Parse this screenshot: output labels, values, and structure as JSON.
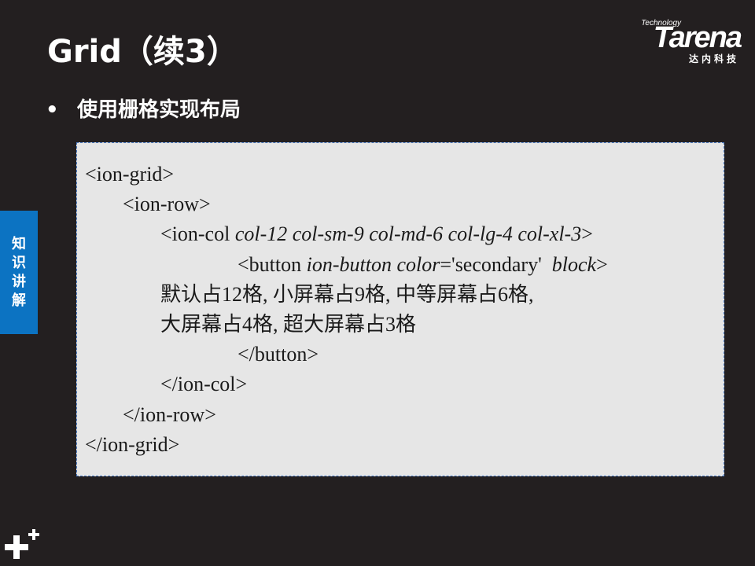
{
  "slide": {
    "title": "Grid（续3）",
    "bullet": "使用栅格实现布局"
  },
  "logo": {
    "tech": "Technology",
    "word": "Tarena",
    "cn": "达内科技"
  },
  "side_tab": {
    "chars": [
      "知",
      "识",
      "讲",
      "解"
    ]
  },
  "code": {
    "l1": "<ion-grid>",
    "l2": "<ion-row>",
    "l3_tag": "<ion-col ",
    "l3_attrs": "col-12 col-sm-9 col-md-6 col-lg-4 col-xl-3",
    "l3_end": ">",
    "l4_tag": "<button ",
    "l4_attr1": "ion-button color",
    "l4_mid": "='secondary'  ",
    "l4_attr2": "block",
    "l4_end": ">",
    "l5": "默认占12格, 小屏幕占9格, 中等屏幕占6格,",
    "l6": "大屏幕占4格, 超大屏幕占3格",
    "l7": "</button>",
    "l8": "</ion-col>",
    "l9": "</ion-row>",
    "l10": "</ion-grid>"
  },
  "colors": {
    "background": "#231f20",
    "code_bg": "#e6e6e6",
    "side_tab": "#0c73c2"
  }
}
